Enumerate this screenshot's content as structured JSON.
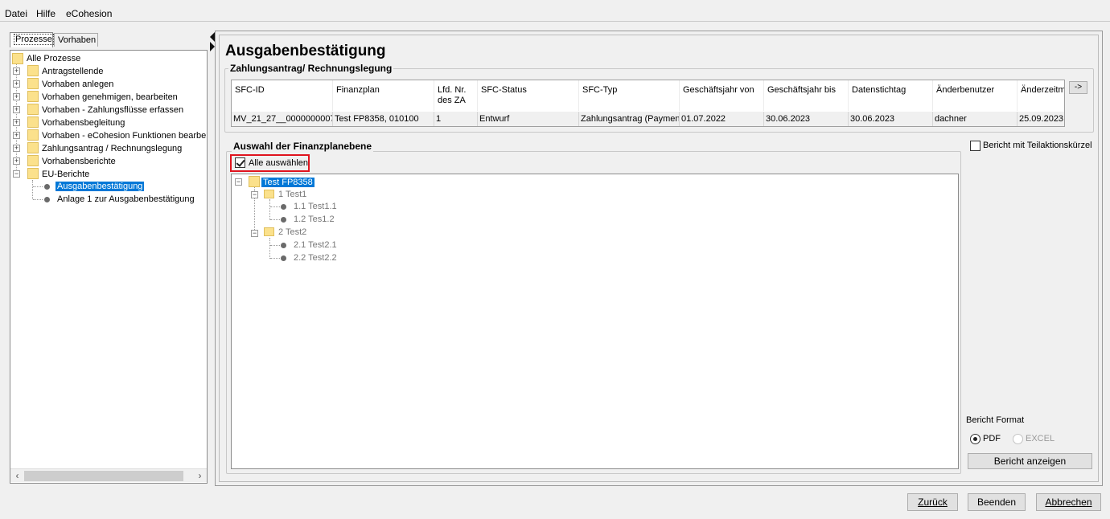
{
  "menu": {
    "datei": "Datei",
    "hilfe": "Hilfe",
    "ecohesion": "eCohesion"
  },
  "tabs": {
    "prozesse": "Prozesse",
    "vorhaben": "Vorhaben"
  },
  "tree": {
    "root": "Alle Prozesse",
    "items": [
      "Antragstellende",
      "Vorhaben anlegen",
      "Vorhaben genehmigen, bearbeiten",
      "Vorhaben - Zahlungsflüsse erfassen",
      "Vorhabensbegleitung",
      "Vorhaben - eCohesion Funktionen bearbeiten",
      "Zahlungsantrag / Rechnungslegung",
      "Vorhabensberichte",
      "EU-Berichte"
    ],
    "children": [
      "Ausgabenbestätigung",
      "Anlage 1 zur Ausgabenbestätigung"
    ]
  },
  "page": {
    "title": "Ausgabenbestätigung",
    "group1": "Zahlungsantrag/ Rechnungslegung",
    "group2": "Auswahl der Finanzplanebene",
    "arrow": "->"
  },
  "table": {
    "headers": [
      "SFC-ID",
      "Finanzplan",
      "Lfd. Nr. des ZA",
      "SFC-Status",
      "SFC-Typ",
      "Geschäftsjahr von",
      "Geschäftsjahr bis",
      "Datenstichtag",
      "Änderbenutzer",
      "Änderzeitm"
    ],
    "row": [
      "MV_21_27__0000000007",
      "Test FP8358, 010100",
      "1",
      "Entwurf",
      "Zahlungsantrag (Payment",
      "01.07.2022",
      "30.06.2023",
      "30.06.2023",
      "dachner",
      "25.09.2023"
    ]
  },
  "select_all": {
    "label": "Alle auswählen",
    "checked": true
  },
  "fin_tree": {
    "root": "Test FP8358",
    "nodes": [
      {
        "label": "1 Test1",
        "children": [
          "1.1 Test1.1",
          "1.2 Tes1.2"
        ]
      },
      {
        "label": "2 Test2",
        "children": [
          "2.1 Test2.1",
          "2.2 Test2.2"
        ]
      }
    ]
  },
  "options": {
    "teilaktion_label": "Bericht mit Teilaktionskürzel",
    "teilaktion_checked": false,
    "format_label": "Bericht Format",
    "pdf": "PDF",
    "excel": "EXCEL",
    "selected_format": "PDF",
    "show_report": "Bericht anzeigen"
  },
  "footer": {
    "back": "Zurück",
    "finish": "Beenden",
    "cancel": "Abbrechen"
  }
}
